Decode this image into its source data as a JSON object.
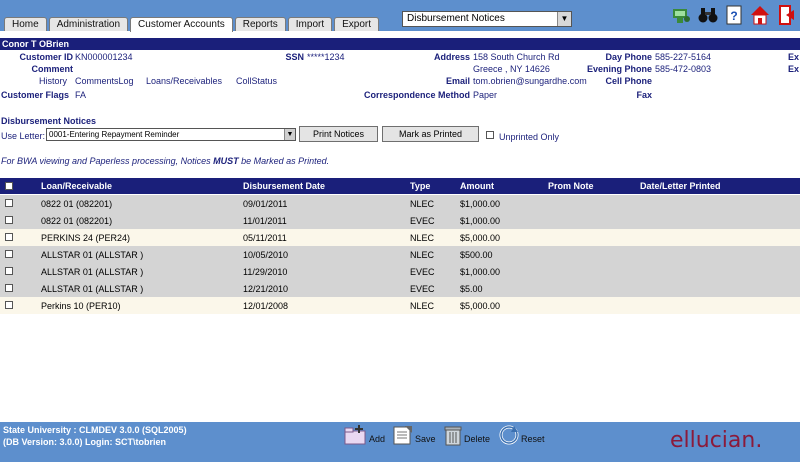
{
  "nav": {
    "tabs": [
      "Home",
      "Administration",
      "Customer Accounts",
      "Reports",
      "Import",
      "Export"
    ],
    "active_tab": "Customer Accounts",
    "dropdown_value": "Disbursement Notices",
    "icons": [
      "people-icon",
      "binoculars-icon",
      "help-icon",
      "home-icon",
      "exit-icon"
    ]
  },
  "customer": {
    "name": "Conor T OBrien",
    "customer_id_label": "Customer ID",
    "customer_id": "KN000001234",
    "ssn_label": "SSN",
    "ssn": "*****1234",
    "comment_label": "Comment",
    "address_label": "Address",
    "address_line1": "158 South Church Rd",
    "address_line2": "Greece , NY 14626",
    "email_label": "Email",
    "email": "tom.obrien@sungardhe.com",
    "corr_label": "Correspondence Method",
    "corr_value": "Paper",
    "day_phone_label": "Day Phone",
    "day_phone": "585-227-5164",
    "eve_phone_label": "Evening Phone",
    "eve_phone": "585-472-0803",
    "cell_label": "Cell Phone",
    "fax_label": "Fax",
    "ex1": "Ex",
    "ex2": "Ex",
    "flags_label": "Customer Flags",
    "flags_value": "FA",
    "links": [
      "History",
      "CommentsLog",
      "Loans/Receivables",
      "CollStatus"
    ]
  },
  "section": {
    "title": "Disbursement Notices",
    "use_letter_label": "Use Letter:",
    "letter_value": "0001-Entering Repayment Reminder",
    "print_button": "Print Notices",
    "mark_button": "Mark as Printed",
    "unprinted_label": "Unprinted Only",
    "note_pre": "For BWA viewing and Paperless processing, Notices ",
    "note_bold": "MUST",
    "note_post": " be Marked as Printed."
  },
  "table": {
    "headers": [
      "Loan/Receivable",
      "Disbursement Date",
      "Type",
      "Amount",
      "Prom Note",
      "Date/Letter Printed"
    ],
    "rows": [
      {
        "loan": "0822  01  (082201)",
        "date": "09/01/2011",
        "type": "NLEC",
        "amount": "$1,000.00",
        "bg": "#d4d4d4",
        "shade": "#d4d4d4"
      },
      {
        "loan": "0822  01  (082201)",
        "date": "11/01/2011",
        "type": "EVEC",
        "amount": "$1,000.00",
        "bg": "#d4d4d4",
        "shade": "#d4d4d4"
      },
      {
        "loan": "PERKINS  24  (PER24)",
        "date": "05/11/2011",
        "type": "NLEC",
        "amount": "$5,000.00",
        "bg": "#fbf7ea",
        "shade": "#fbf7ea"
      },
      {
        "loan": "ALLSTAR  01  (ALLSTAR )",
        "date": "10/05/2010",
        "type": "NLEC",
        "amount": "$500.00",
        "bg": "#d4d4d4",
        "shade": "#d4d4d4"
      },
      {
        "loan": "ALLSTAR  01  (ALLSTAR )",
        "date": "11/29/2010",
        "type": "EVEC",
        "amount": "$1,000.00",
        "bg": "#d4d4d4",
        "shade": "#d4d4d4"
      },
      {
        "loan": "ALLSTAR  01  (ALLSTAR )",
        "date": "12/21/2010",
        "type": "EVEC",
        "amount": "$5.00",
        "bg": "#d4d4d4",
        "shade": "#d4d4d4"
      },
      {
        "loan": "Perkins  10  (PER10)",
        "date": "12/01/2008",
        "type": "NLEC",
        "amount": "$5,000.00",
        "bg": "#fbf7ea",
        "shade": "#fbf7ea"
      }
    ]
  },
  "footer": {
    "line1": "State University : CLMDEV 3.0.0 (SQL2005)",
    "line2": "(DB Version: 3.0.0) Login: SCT\\tobrien",
    "add": "Add",
    "save": "Save",
    "delete": "Delete",
    "reset": "Reset",
    "logo": "ellucian."
  },
  "colors": {
    "nav_bg": "#5d8fcd",
    "dark_blue": "#1a1f7a",
    "logo": "#8b1a3a"
  }
}
